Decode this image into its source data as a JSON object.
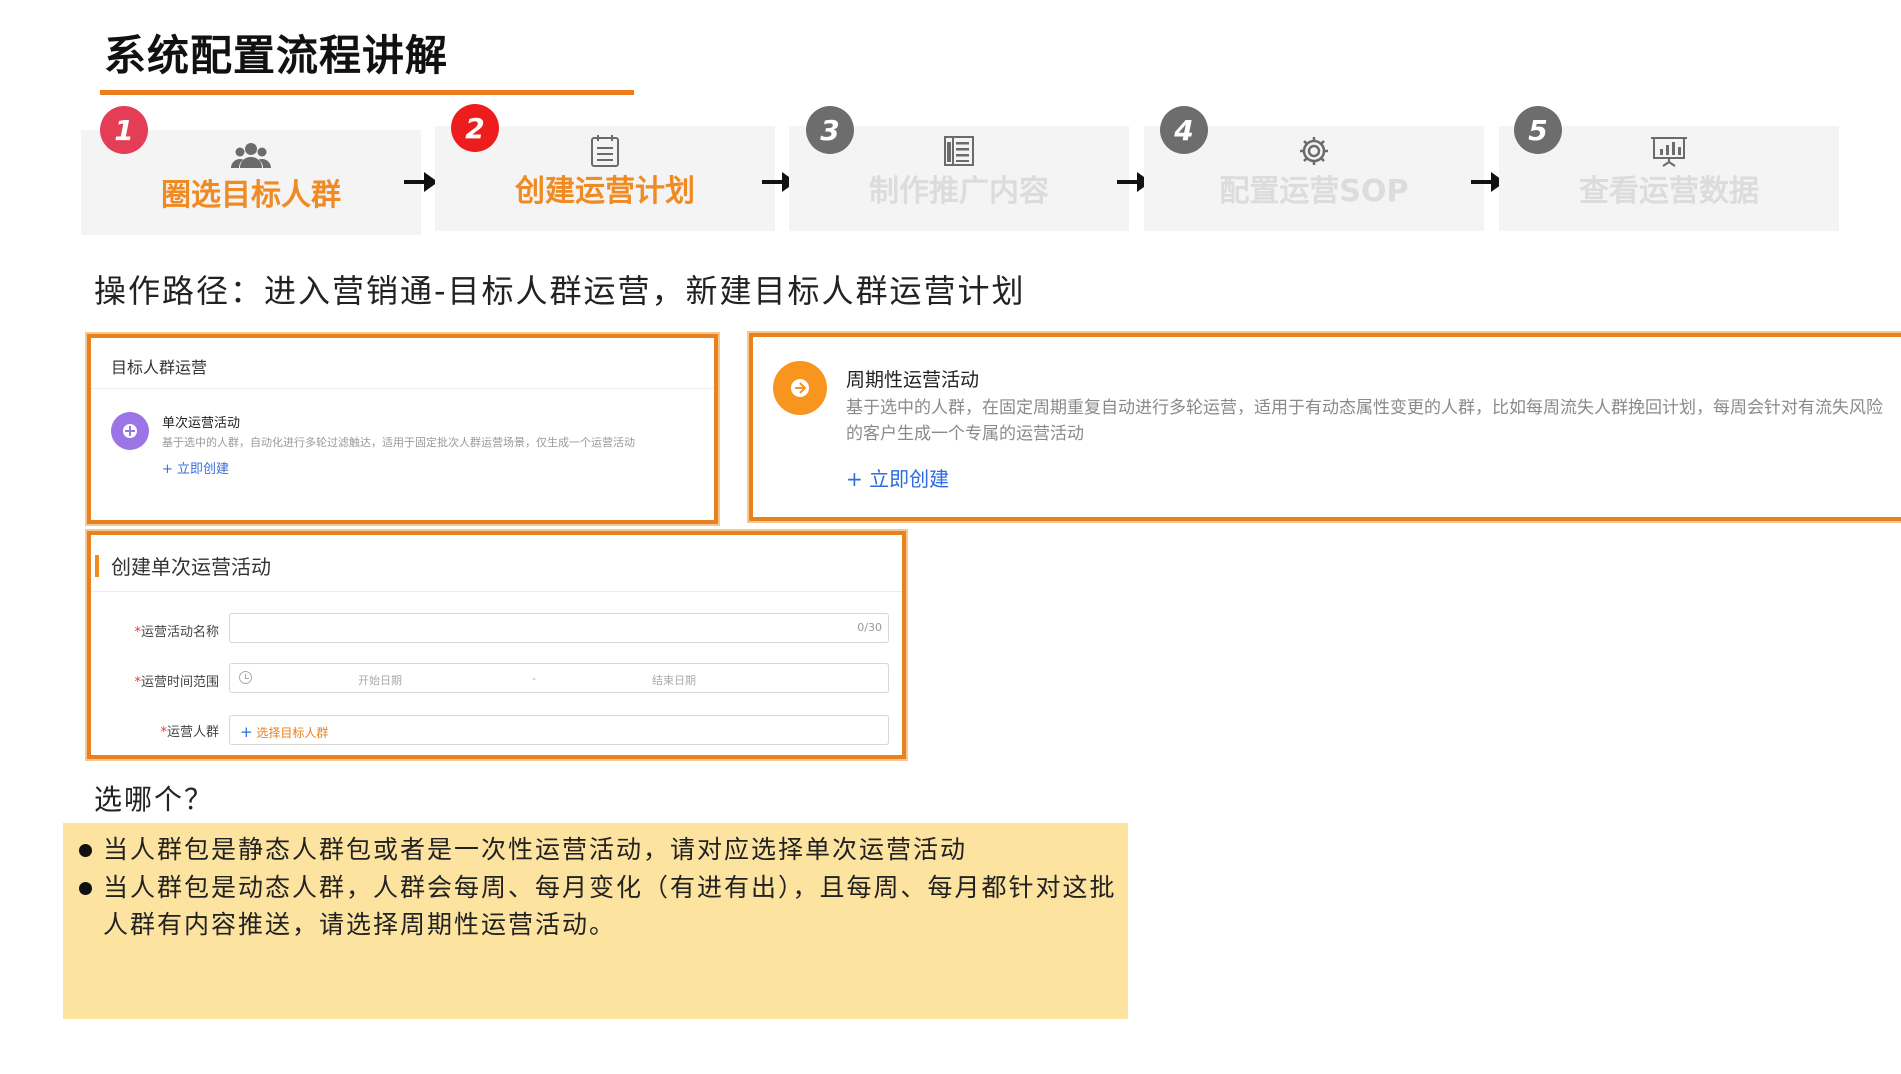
{
  "page": {
    "title": "系统配置流程讲解",
    "op_path": "操作路径：进入营销通-目标人群运营，新建目标人群运营计划"
  },
  "steps": [
    {
      "num": "1",
      "label": "圈选目标人群",
      "icon": "users-icon",
      "state": "active"
    },
    {
      "num": "2",
      "label": "创建运营计划",
      "icon": "calendar-list-icon",
      "state": "active"
    },
    {
      "num": "3",
      "label": "制作推广内容",
      "icon": "document-icon",
      "state": "inactive"
    },
    {
      "num": "4",
      "label": "配置运营SOP",
      "icon": "gear-icon",
      "state": "inactive"
    },
    {
      "num": "5",
      "label": "查看运营数据",
      "icon": "presentation-chart-icon",
      "state": "inactive"
    }
  ],
  "panel_single": {
    "header": "目标人群运营",
    "title": "单次运营活动",
    "desc": "基于选中的人群，自动化进行多轮过滤触达，适用于固定批次人群运营场景，仅生成一个运营活动",
    "link": "+ 立即创建"
  },
  "panel_periodic": {
    "title": "周期性运营活动",
    "desc": "基于选中的人群，在固定周期重复自动进行多轮运营，适用于有动态属性变更的人群，比如每周流失人群挽回计划，每周会针对有流失风险的客户生成一个专属的运营活动",
    "link": "+ 立即创建"
  },
  "create_form": {
    "header": "创建单次运营活动",
    "fields": {
      "name_label": "运营活动名称",
      "name_counter": "0/30",
      "time_label": "运营时间范围",
      "start_placeholder": "开始日期",
      "separator": "-",
      "end_placeholder": "结束日期",
      "crowd_label": "运营人群",
      "crowd_plus": "+",
      "crowd_select": "选择目标人群"
    },
    "required_mark": "*"
  },
  "which": {
    "question": "选哪个？",
    "bullets": [
      "当人群包是静态人群包或者是一次性运营活动，请对应选择单次运营活动",
      "当人群包是动态人群，人群会每周、每月变化（有进有出），且每周、每月都针对这批人群有内容推送，请选择周期性运营活动。"
    ]
  },
  "colors": {
    "accent_orange": "#e8811f",
    "step_active_text": "#f08a22",
    "badge_red": "#e43d56",
    "note_bg": "#fde3a0",
    "link_blue": "#2d6be0"
  }
}
